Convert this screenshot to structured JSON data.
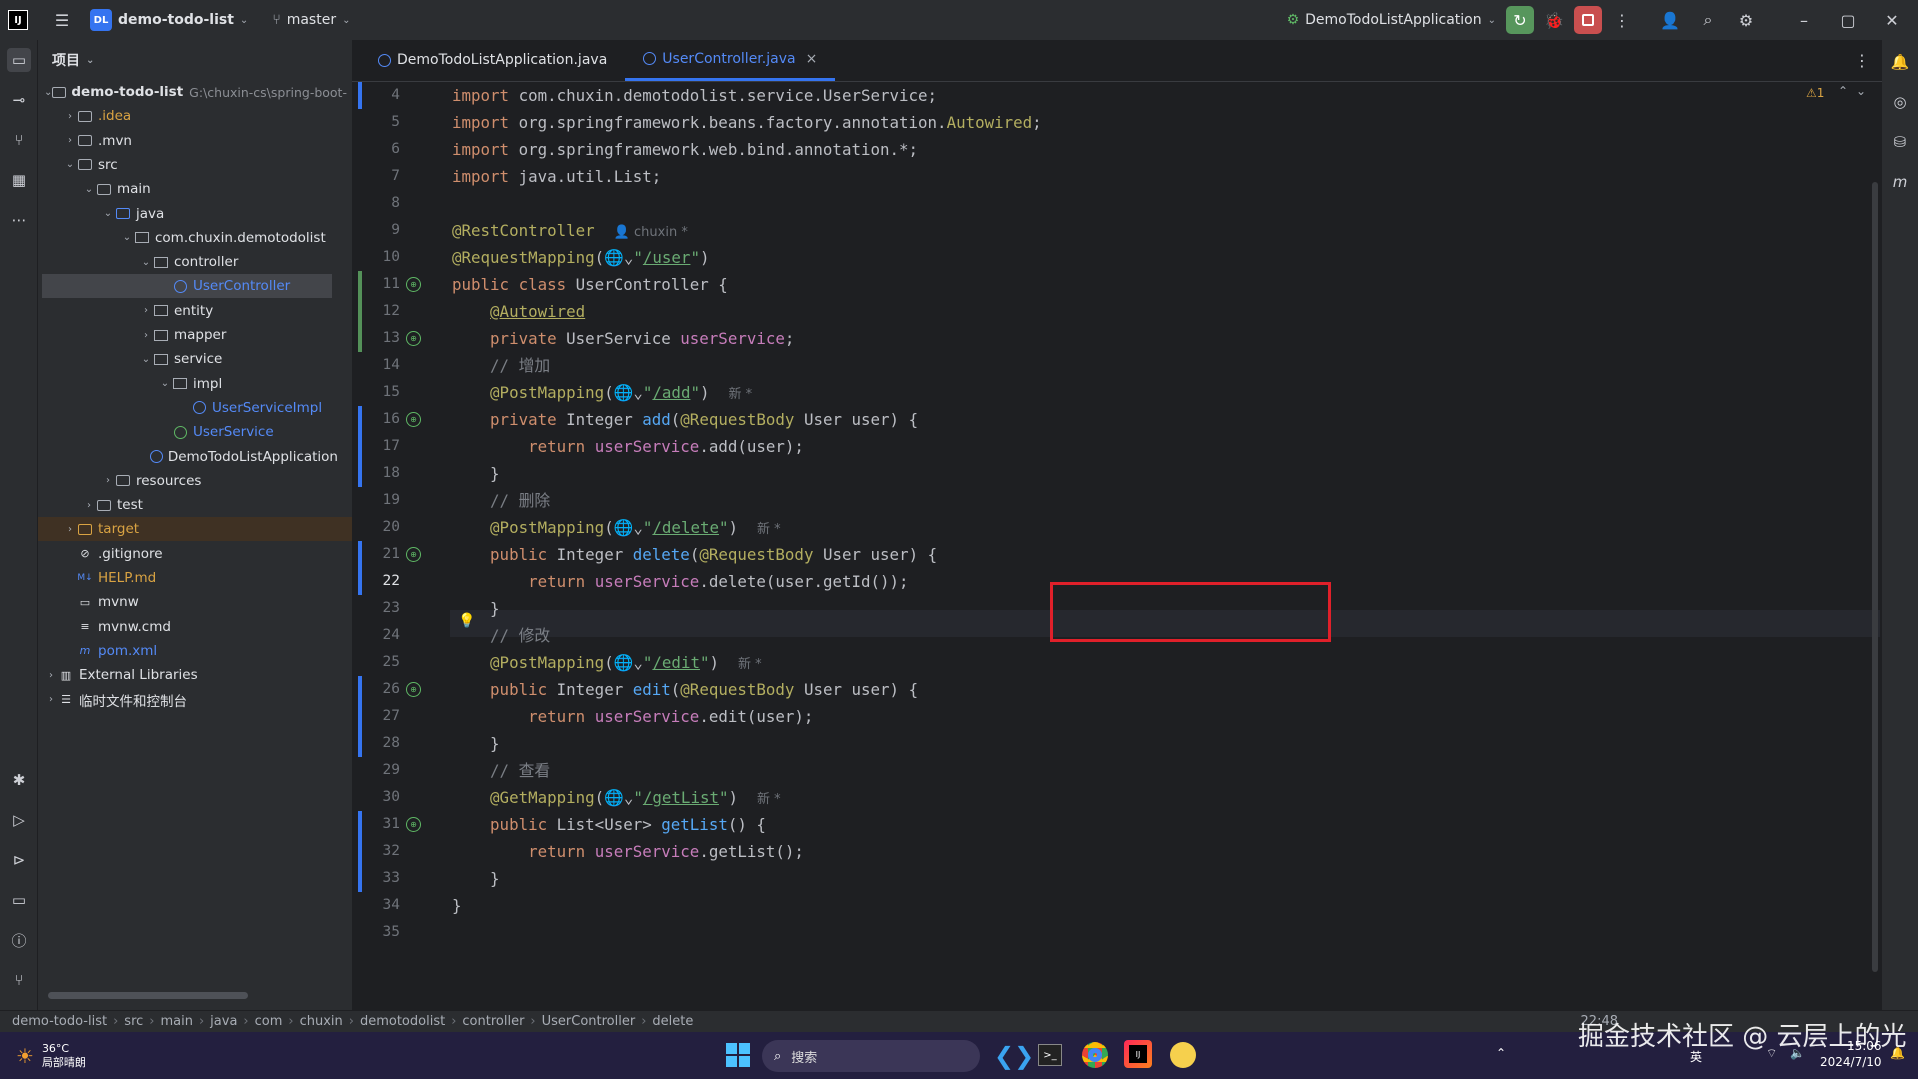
{
  "titlebar": {
    "logo": "IJ",
    "project_badge": "DL",
    "project_name": "demo-todo-list",
    "branch": "master",
    "run_config": "DemoTodoListApplication",
    "win_minimize": "–",
    "win_restore": "▢",
    "win_close": "✕"
  },
  "project_panel": {
    "title": "项目",
    "tree": [
      {
        "label": "demo-todo-list",
        "extra": "G:\\chuxin-cs\\spring-boot-",
        "depth": 0,
        "chev": "down",
        "icon": "folder",
        "bold": true
      },
      {
        "label": ".idea",
        "depth": 1,
        "chev": "right",
        "icon": "folder",
        "color": "orange-text"
      },
      {
        "label": ".mvn",
        "depth": 1,
        "chev": "right",
        "icon": "folder"
      },
      {
        "label": "src",
        "depth": 1,
        "chev": "down",
        "icon": "folder"
      },
      {
        "label": "main",
        "depth": 2,
        "chev": "down",
        "icon": "folder"
      },
      {
        "label": "java",
        "depth": 3,
        "chev": "down",
        "icon": "folder-blue"
      },
      {
        "label": "com.chuxin.demotodolist",
        "depth": 4,
        "chev": "down",
        "icon": "package"
      },
      {
        "label": "controller",
        "depth": 5,
        "chev": "down",
        "icon": "package"
      },
      {
        "label": "UserController",
        "depth": 6,
        "chev": "none",
        "icon": "class",
        "selected": true,
        "color": "blue-text"
      },
      {
        "label": "entity",
        "depth": 5,
        "chev": "right",
        "icon": "package"
      },
      {
        "label": "mapper",
        "depth": 5,
        "chev": "right",
        "icon": "package"
      },
      {
        "label": "service",
        "depth": 5,
        "chev": "down",
        "icon": "package"
      },
      {
        "label": "impl",
        "depth": 6,
        "chev": "down",
        "icon": "package"
      },
      {
        "label": "UserServiceImpl",
        "depth": 7,
        "chev": "none",
        "icon": "class",
        "color": "blue-text"
      },
      {
        "label": "UserService",
        "depth": 6,
        "chev": "none",
        "icon": "interface",
        "color": "blue-text"
      },
      {
        "label": "DemoTodoListApplication",
        "depth": 5,
        "chev": "none",
        "icon": "class"
      },
      {
        "label": "resources",
        "depth": 3,
        "chev": "right",
        "icon": "folder"
      },
      {
        "label": "test",
        "depth": 2,
        "chev": "right",
        "icon": "folder"
      },
      {
        "label": "target",
        "depth": 1,
        "chev": "right",
        "icon": "folder-orange",
        "target": true,
        "color": "orange-text"
      },
      {
        "label": ".gitignore",
        "depth": 1,
        "chev": "none",
        "icon": "ignore"
      },
      {
        "label": "HELP.md",
        "depth": 1,
        "chev": "none",
        "icon": "md",
        "color": "orange-text"
      },
      {
        "label": "mvnw",
        "depth": 1,
        "chev": "none",
        "icon": "file"
      },
      {
        "label": "mvnw.cmd",
        "depth": 1,
        "chev": "none",
        "icon": "lines"
      },
      {
        "label": "pom.xml",
        "depth": 1,
        "chev": "none",
        "icon": "maven",
        "color": "blue-text"
      },
      {
        "label": "External Libraries",
        "depth": 0,
        "chev": "right",
        "icon": "lib"
      },
      {
        "label": "临时文件和控制台",
        "depth": 0,
        "chev": "right",
        "icon": "scratch"
      }
    ]
  },
  "tabs": [
    {
      "label": "DemoTodoListApplication.java",
      "active": false
    },
    {
      "label": "UserController.java",
      "active": true,
      "close": "×"
    }
  ],
  "editor": {
    "warning_count": "⚠1",
    "current_line": 22,
    "lines": [
      {
        "n": 4,
        "html": "<span class='kw'>import</span> com.chuxin.demotodolist.service.UserService;"
      },
      {
        "n": 5,
        "html": "<span class='kw'>import</span> org.springframework.beans.factory.annotation.<span class='an'>Autowired</span>;"
      },
      {
        "n": 6,
        "html": "<span class='kw'>import</span> org.springframework.web.bind.annotation.*;"
      },
      {
        "n": 7,
        "html": "<span class='kw'>import</span> java.util.List;"
      },
      {
        "n": 8,
        "html": ""
      },
      {
        "n": 9,
        "html": "<span class='an'>@RestController</span>  <span class='hint'>👤 chuxin *</span>"
      },
      {
        "n": 10,
        "html": "<span class='an'>@RequestMapping</span>(🌐⌄<span class='st'>\"</span><span class='url'>/user</span><span class='st'>\"</span>)"
      },
      {
        "n": 11,
        "html": "<span class='kw'>public class</span> UserController {"
      },
      {
        "n": 12,
        "html": "    <span class='an' style='text-decoration:underline'>@Autowired</span>"
      },
      {
        "n": 13,
        "html": "    <span class='kw'>private</span> UserService <span class='fld'>userService</span>;"
      },
      {
        "n": 14,
        "html": "    <span class='cm'>// 增加</span>"
      },
      {
        "n": 15,
        "html": "    <span class='an'>@PostMapping</span>(🌐⌄<span class='st'>\"</span><span class='url'>/add</span><span class='st'>\"</span>)  <span class='hint'>新 *</span>"
      },
      {
        "n": 16,
        "html": "    <span class='kw'>private</span> Integer <span class='fn'>add</span>(<span class='an'>@RequestBody</span> User user) {"
      },
      {
        "n": 17,
        "html": "        <span class='kw'>return</span> <span class='fld'>userService</span>.add(user);"
      },
      {
        "n": 18,
        "html": "    }"
      },
      {
        "n": 19,
        "html": "    <span class='cm'>// 删除</span>"
      },
      {
        "n": 20,
        "html": "    <span class='an'>@PostMapping</span>(🌐⌄<span class='st'>\"</span><span class='url'>/delete</span><span class='st'>\"</span>)  <span class='hint'>新 *</span>"
      },
      {
        "n": 21,
        "html": "    <span class='kw'>public</span> Integer <span class='fn'>delete</span>(<span class='an'>@RequestBody</span> User user) {"
      },
      {
        "n": 22,
        "html": "        <span class='kw'>return</span> <span class='fld'>userService</span>.delete(user.getId());"
      },
      {
        "n": 23,
        "html": "    }"
      },
      {
        "n": 24,
        "html": "    <span class='cm'>// 修改</span>"
      },
      {
        "n": 25,
        "html": "    <span class='an'>@PostMapping</span>(🌐⌄<span class='st'>\"</span><span class='url'>/edit</span><span class='st'>\"</span>)  <span class='hint'>新 *</span>"
      },
      {
        "n": 26,
        "html": "    <span class='kw'>public</span> Integer <span class='fn'>edit</span>(<span class='an'>@RequestBody</span> User user) {"
      },
      {
        "n": 27,
        "html": "        <span class='kw'>return</span> <span class='fld'>userService</span>.edit(user);"
      },
      {
        "n": 28,
        "html": "    }"
      },
      {
        "n": 29,
        "html": "    <span class='cm'>// 查看</span>"
      },
      {
        "n": 30,
        "html": "    <span class='an'>@GetMapping</span>(🌐⌄<span class='st'>\"</span><span class='url'>/getList</span><span class='st'>\"</span>)  <span class='hint'>新 *</span>"
      },
      {
        "n": 31,
        "html": "    <span class='kw'>public</span> List&lt;User&gt; <span class='fn'>getList</span>() {"
      },
      {
        "n": 32,
        "html": "        <span class='kw'>return</span> <span class='fld'>userService</span>.getList();"
      },
      {
        "n": 33,
        "html": "    }"
      },
      {
        "n": 34,
        "html": "}"
      },
      {
        "n": 35,
        "html": ""
      }
    ]
  },
  "breadcrumb": [
    "demo-todo-list",
    "src",
    "main",
    "java",
    "com",
    "chuxin",
    "demotodolist",
    "controller",
    "UserController",
    "delete"
  ],
  "status": {
    "time": "22:48"
  },
  "taskbar": {
    "weather_temp": "36°C",
    "weather_desc": "局部晴朗",
    "search_placeholder": "搜索",
    "lang": "英",
    "clock_time": "15:06",
    "clock_date": "2024/7/10"
  },
  "watermark": "掘金技术社区 @ 云层上的光",
  "colors": {
    "accent": "#3574f0",
    "highlight_box": "#e0202a"
  }
}
